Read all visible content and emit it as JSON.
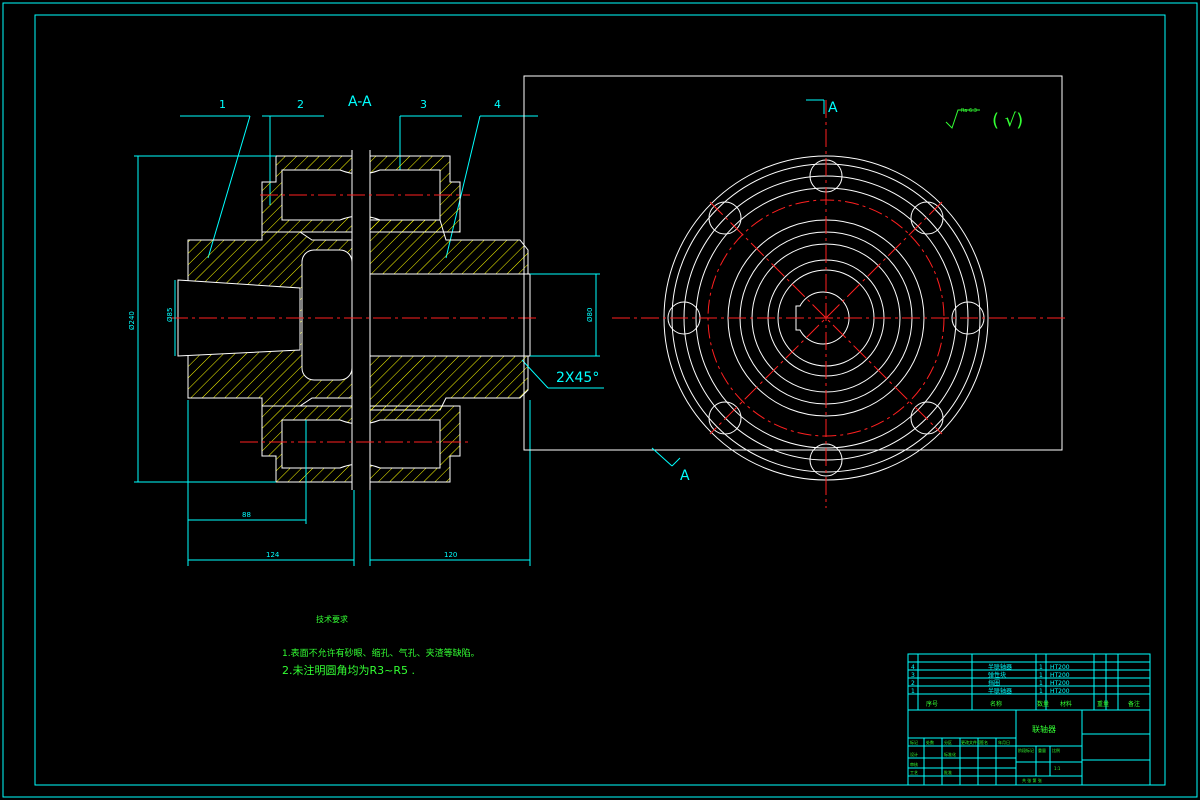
{
  "section_title": "A-A",
  "callouts": [
    "1",
    "2",
    "3",
    "4"
  ],
  "view_marker": "A",
  "dimensions": {
    "dia_outer": "Ø240",
    "dia_bore_left": "Ø85",
    "dia_bore_right": "Ø80",
    "chamfer": "2X45°",
    "len_short": "88",
    "len_left": "124",
    "len_right": "120"
  },
  "surface_finish": {
    "mark": "Ra 6.3",
    "paren": "( √)"
  },
  "notes": {
    "heading": "技术要求",
    "line1": "1.表面不允许有砂眼、缩孔、气孔、夹渣等缺陷。",
    "line2": "2.未注明圆角均为R3~R5 ."
  },
  "bom": {
    "rows": [
      {
        "no": "4",
        "name": "半联轴器",
        "qty": "1",
        "material": "HT200"
      },
      {
        "no": "3",
        "name": "弹性块",
        "qty": "1",
        "material": "HT200"
      },
      {
        "no": "2",
        "name": "挡圈",
        "qty": "1",
        "material": "HT200"
      },
      {
        "no": "1",
        "name": "半联轴器",
        "qty": "1",
        "material": "HT200"
      }
    ],
    "header": [
      "序号",
      "名称",
      "数量",
      "材料",
      "重量",
      "备注"
    ]
  },
  "title_block": {
    "drawing_name": "联轴器",
    "small_labels": [
      "标记",
      "处数",
      "分区",
      "更改文件号",
      "签名",
      "年月日",
      "设计",
      "标准化",
      "审核",
      "工艺",
      "批准",
      "比例",
      "阶段标记",
      "重量",
      "共 张 第 张"
    ],
    "scale": "1:1"
  },
  "colors": {
    "frame": "#00ffff",
    "geometry": "#ffffff",
    "hatch": "#ffff00",
    "centerline": "#ff2020",
    "text": "#33ff33"
  }
}
